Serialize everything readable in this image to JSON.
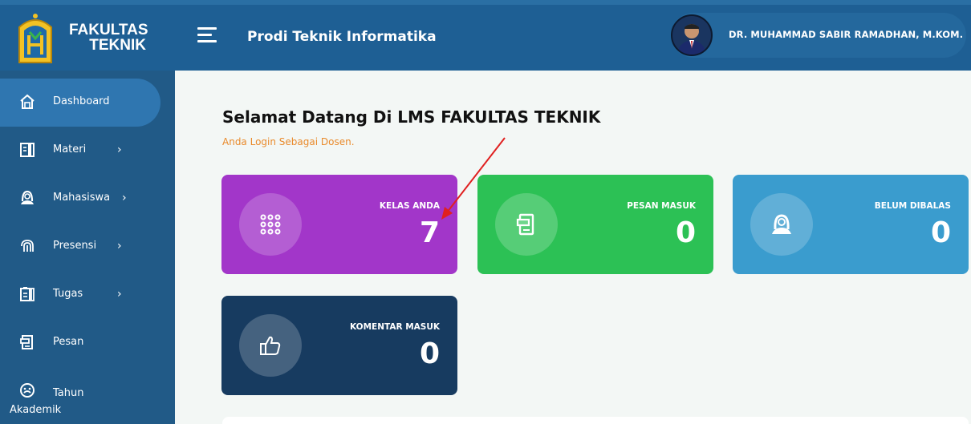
{
  "header": {
    "brand_line1": "FAKULTAS",
    "brand_line2": "TEKNIK",
    "subtitle": "Prodi Teknik Informatika",
    "user_name": "DR. MUHAMMAD SABIR RAMADHAN, M.KOM."
  },
  "sidebar": {
    "items": [
      {
        "label": "Dashboard",
        "icon": "home-icon",
        "active": true
      },
      {
        "label": "Materi",
        "icon": "book-icon",
        "chevron": true
      },
      {
        "label": "Mahasiswa",
        "icon": "user-icon",
        "chevron": true
      },
      {
        "label": "Presensi",
        "icon": "fingerprint-icon",
        "chevron": true
      },
      {
        "label": "Tugas",
        "icon": "clipboard-icon",
        "chevron": true
      },
      {
        "label": "Pesan",
        "icon": "message-icon"
      },
      {
        "label": "Tahun Akademik",
        "icon": "gauge-icon"
      }
    ]
  },
  "main": {
    "welcome": "Selamat Datang Di LMS FAKULTAS TEKNIK",
    "login_as": "Anda Login Sebagai Dosen.",
    "cards": [
      {
        "label": "KELAS ANDA",
        "value": "7",
        "icon": "grid-icon",
        "color": "#a236c9"
      },
      {
        "label": "PESAN MASUK",
        "value": "0",
        "icon": "message-icon",
        "color": "#2cc155"
      },
      {
        "label": "BELUM DIBALAS",
        "value": "0",
        "icon": "user-icon",
        "color": "#3a9cce"
      },
      {
        "label": "KOMENTAR MASUK",
        "value": "0",
        "icon": "thumbs-up-icon",
        "color": "#173b60"
      }
    ]
  },
  "colors": {
    "topbar": "#1e5f94",
    "sidebar": "#215a87",
    "accent_orange": "#e98a2b",
    "annotation_arrow": "#e02020"
  }
}
